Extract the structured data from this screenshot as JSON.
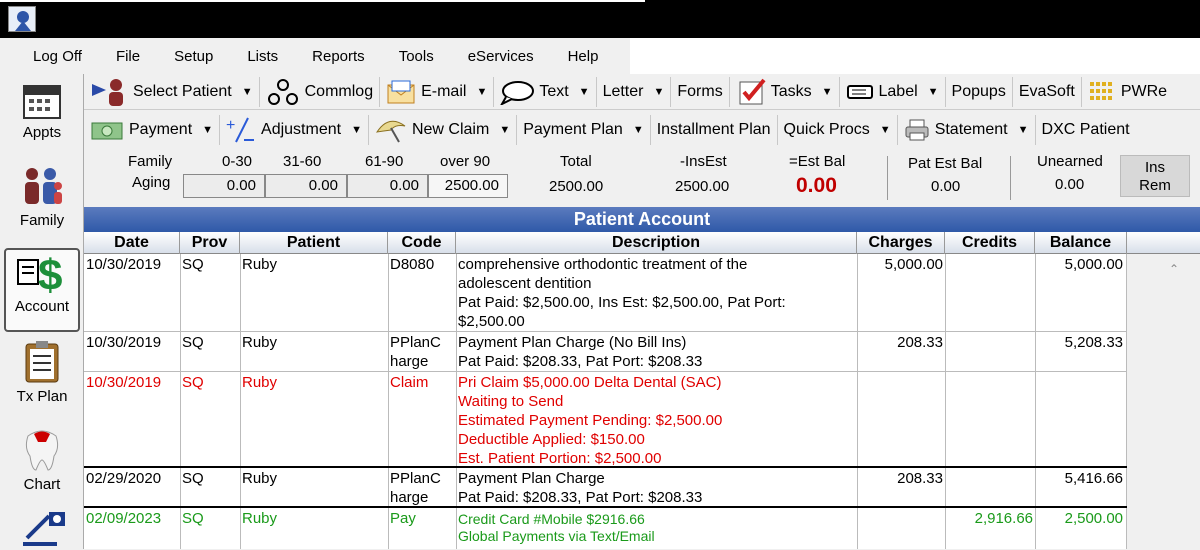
{
  "menu": [
    "Log Off",
    "File",
    "Setup",
    "Lists",
    "Reports",
    "Tools",
    "eServices",
    "Help"
  ],
  "modules": [
    "Appts",
    "Family",
    "Account",
    "Tx Plan",
    "Chart"
  ],
  "toolbar1": [
    {
      "label": "Select Patient",
      "dd": true,
      "icon": "select-patient-icon"
    },
    {
      "label": "Commlog",
      "dd": false,
      "icon": "commlog-icon"
    },
    {
      "label": "E-mail",
      "dd": true,
      "icon": "email-icon"
    },
    {
      "label": "Text",
      "dd": true,
      "icon": "text-bubble-icon"
    },
    {
      "label": "Letter",
      "dd": true,
      "icon": ""
    },
    {
      "label": "Forms",
      "dd": false,
      "icon": ""
    },
    {
      "label": "Tasks",
      "dd": true,
      "icon": "tasks-icon"
    },
    {
      "label": "Label",
      "dd": true,
      "icon": "label-icon"
    },
    {
      "label": "Popups",
      "dd": false,
      "icon": ""
    },
    {
      "label": "EvaSoft",
      "dd": false,
      "icon": ""
    },
    {
      "label": "PWRe",
      "dd": false,
      "icon": "pwre-icon"
    }
  ],
  "toolbar2": [
    {
      "label": "Payment",
      "dd": true,
      "icon": "payment-icon"
    },
    {
      "label": "Adjustment",
      "dd": true,
      "icon": "adjustment-icon"
    },
    {
      "label": "New Claim",
      "dd": true,
      "icon": "new-claim-icon"
    },
    {
      "label": "Payment Plan",
      "dd": true,
      "icon": ""
    },
    {
      "label": "Installment Plan",
      "dd": false,
      "icon": ""
    },
    {
      "label": "Quick Procs",
      "dd": true,
      "icon": ""
    },
    {
      "label": "Statement",
      "dd": true,
      "icon": "printer-icon"
    },
    {
      "label": "DXC Patient",
      "dd": false,
      "icon": ""
    }
  ],
  "aging": {
    "family_label": "Family",
    "aging_label": "Aging",
    "col_0_30": "0-30",
    "col_31_60": "31-60",
    "col_61_90": "61-90",
    "col_over90": "over 90",
    "v_0_30": "0.00",
    "v_31_60": "0.00",
    "v_61_90": "0.00",
    "v_over90": "2500.00",
    "total_label": "Total",
    "total": "2500.00",
    "insest_label": "-InsEst",
    "insest": "2500.00",
    "estbal_label": "=Est Bal",
    "estbal": "0.00",
    "patest_label": "Pat Est Bal",
    "patest": "0.00",
    "unearned_label": "Unearned",
    "unearned": "0.00",
    "insrem_label": "Ins\nRem"
  },
  "grid_title": "Patient Account",
  "columns": [
    "Date",
    "Prov",
    "Patient",
    "Code",
    "Description",
    "Charges",
    "Credits",
    "Balance"
  ],
  "rows": [
    {
      "date": "10/30/2019",
      "prov": "SQ",
      "patient": "Ruby",
      "code": "D8080",
      "desc": " comprehensive orthodontic treatment of the\nadolescent dentition\nPat Paid: $2,500.00, Ins Est: $2,500.00, Pat Port:\n$2,500.00",
      "charges": "5,000.00",
      "credits": "",
      "balance": "5,000.00",
      "color": "black"
    },
    {
      "date": "10/30/2019",
      "prov": "SQ",
      "patient": "Ruby",
      "code": "PPlanC\nharge",
      "desc": " Payment Plan Charge  (No Bill Ins)\nPat Paid: $208.33, Pat Port: $208.33",
      "charges": "208.33",
      "credits": "",
      "balance": "5,208.33",
      "color": "black"
    },
    {
      "date": "10/30/2019",
      "prov": "SQ",
      "patient": "Ruby",
      "code": "Claim",
      "desc": "Pri Claim $5,000.00 Delta Dental (SAC)\nWaiting to Send\nEstimated Payment Pending: $2,500.00\nDeductible Applied: $150.00\nEst. Patient Portion: $2,500.00",
      "charges": "",
      "credits": "",
      "balance": "",
      "color": "red"
    },
    {
      "date": "02/29/2020",
      "prov": "SQ",
      "patient": "Ruby",
      "code": "PPlanC\nharge",
      "desc": " Payment Plan Charge\nPat Paid: $208.33, Pat Port: $208.33",
      "charges": "208.33",
      "credits": "",
      "balance": "5,416.66",
      "color": "black"
    },
    {
      "date": "02/09/2023",
      "prov": "SQ",
      "patient": "Ruby",
      "code": "Pay",
      "desc": " Credit Card #Mobile $2916.66\n Global Payments via Text/Email",
      "charges": "",
      "credits": "2,916.66",
      "balance": "2,500.00",
      "color": "green"
    }
  ]
}
